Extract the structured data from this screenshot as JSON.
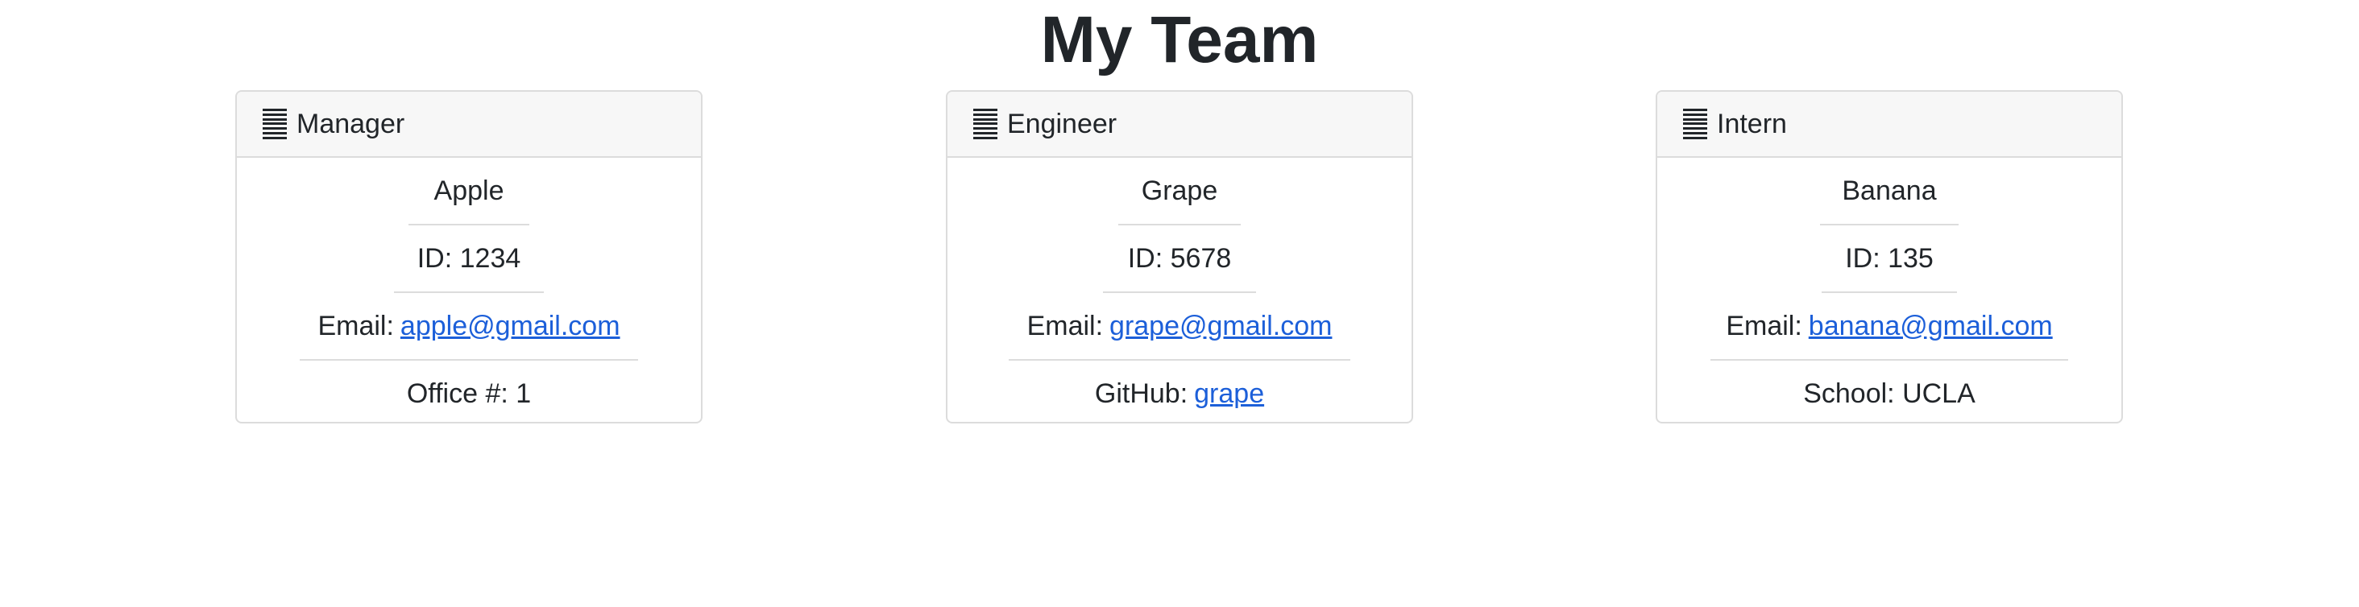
{
  "page_title": "My Team",
  "cards": [
    {
      "role": "Manager",
      "icon": "list-icon",
      "name": "Apple",
      "id_text": "ID: 1234",
      "email_label": "Email:",
      "email": "apple@gmail.com",
      "extra_label": "Office #: 1",
      "extra_link": ""
    },
    {
      "role": "Engineer",
      "icon": "list-icon",
      "name": "Grape",
      "id_text": "ID: 5678",
      "email_label": "Email:",
      "email": "grape@gmail.com",
      "extra_label": "GitHub:",
      "extra_link": "grape"
    },
    {
      "role": "Intern",
      "icon": "list-icon",
      "name": "Banana",
      "id_text": "ID: 135",
      "email_label": "Email:",
      "email": "banana@gmail.com",
      "extra_label": "School: UCLA",
      "extra_link": ""
    }
  ],
  "colors": {
    "link": "#1c5fd9",
    "header_bg": "#f7f7f7",
    "border": "#dcdcdc",
    "text": "#212529"
  }
}
